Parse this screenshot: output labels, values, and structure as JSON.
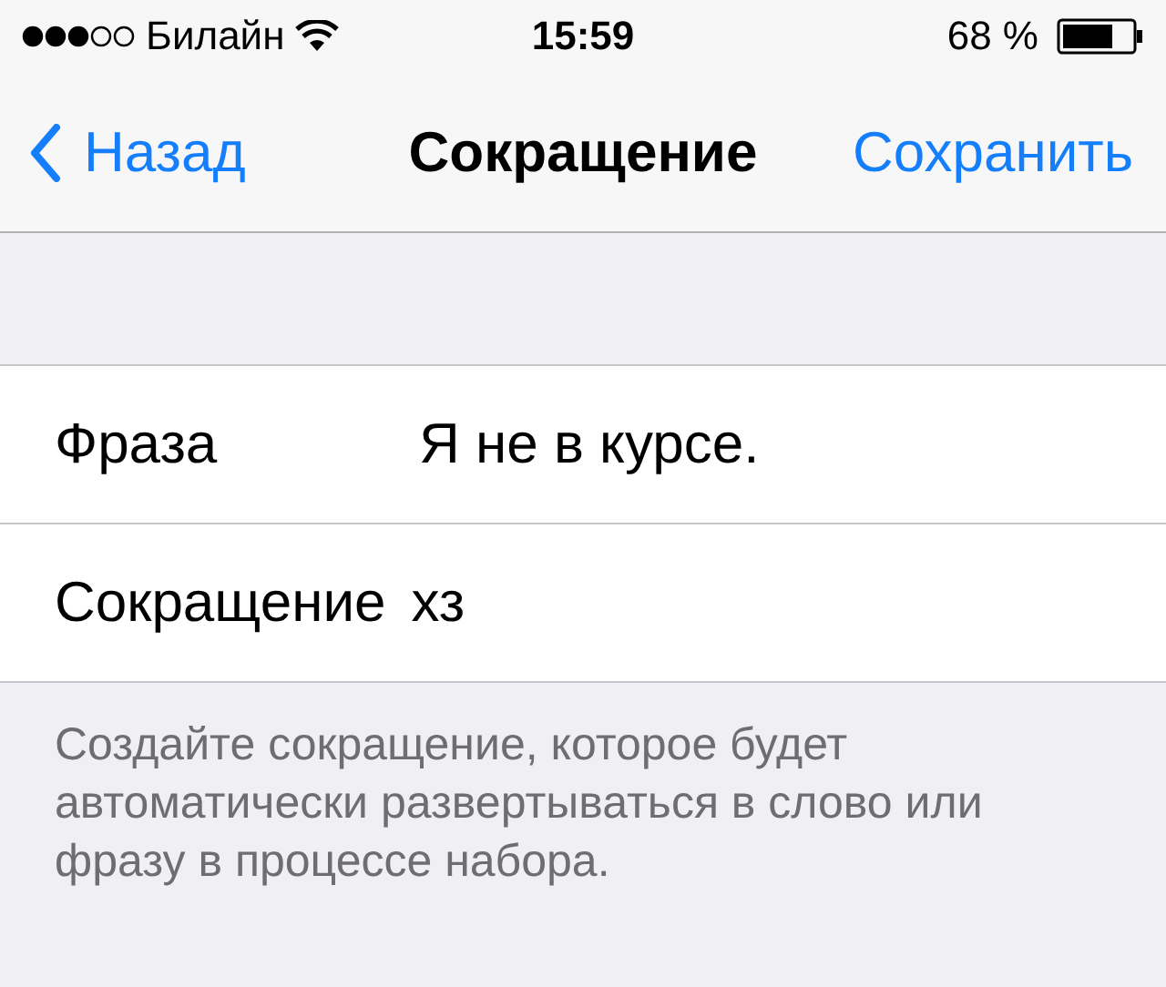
{
  "status_bar": {
    "carrier": "Билайн",
    "time": "15:59",
    "battery": "68 %"
  },
  "nav_bar": {
    "back": "Назад",
    "title": "Сокращение",
    "action": "Сохранить"
  },
  "fields": [
    {
      "label": "Фраза",
      "value": "Я не в курсе."
    },
    {
      "label": "Сокращение",
      "value": "хз"
    }
  ],
  "footer": "Создайте сокращение, которое будет автоматически развертываться в слово или фразу в процессе набора."
}
